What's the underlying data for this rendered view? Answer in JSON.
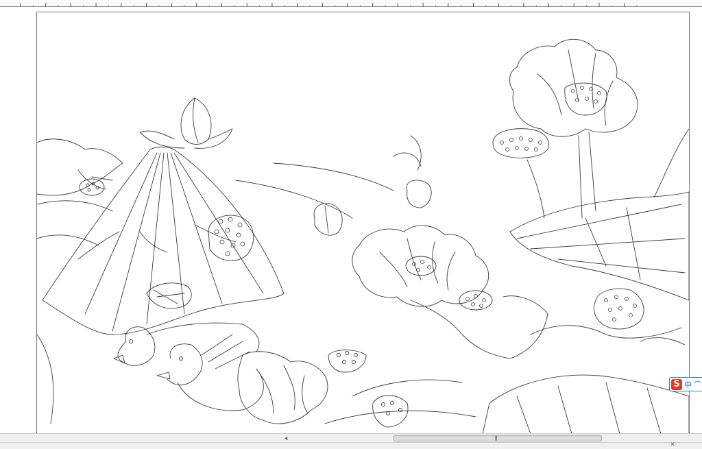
{
  "ruler": {
    "ticks": 24
  },
  "canvas": {
    "artwork": "line-art-lotus-and-mandarin-ducks"
  },
  "scrollbar": {
    "left_arrow": "◂",
    "grip": "|||"
  },
  "statusbar": {
    "close": "×"
  },
  "ime": {
    "logo": "S",
    "mode": "中",
    "punct": "⌒"
  },
  "colors": {
    "stroke": "#3a3a3a",
    "ime_accent": "#1b7bd6",
    "ime_logo": "#e8391d"
  }
}
